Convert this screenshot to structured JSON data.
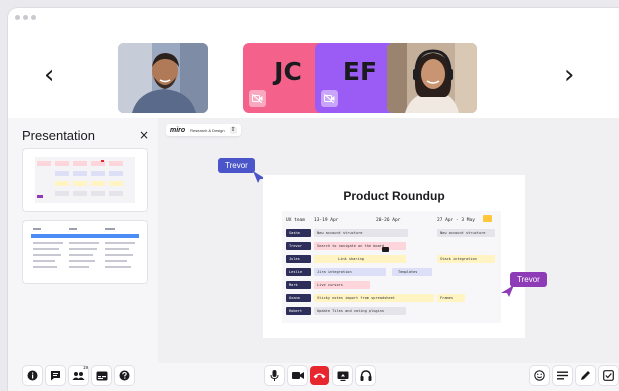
{
  "participants": [
    {
      "name": "participant-1",
      "initials": "",
      "video": true,
      "bg": "#8a9ab8"
    },
    {
      "name": "participant-jc",
      "initials": "JC",
      "video": false,
      "bg": "#f4628b"
    },
    {
      "name": "participant-ef",
      "initials": "EF",
      "video": false,
      "bg": "#9b5cf6"
    },
    {
      "name": "participant-4",
      "initials": "",
      "video": true,
      "bg": "#b9a38c"
    }
  ],
  "sidebar": {
    "title": "Presentation",
    "close": "×"
  },
  "miro": {
    "logo": "miro",
    "board_name": "Research & Design",
    "share_icon": "⇧"
  },
  "cursors": [
    {
      "label": "Trevor",
      "color": "#4a55c9"
    },
    {
      "label": "Trevor",
      "color": "#8d3bb6"
    }
  ],
  "frame": {
    "title": "Product Roundup",
    "headers": [
      "UX team",
      "13-19 Apr",
      "20-26 Apr",
      "27 Apr - 3 May"
    ],
    "rows": [
      {
        "name": "Sasha",
        "cells": [
          {
            "text": "New account structure",
            "color": "#e4e4ea"
          },
          {
            "text": "New account structure",
            "color": "#e4e4ea"
          }
        ]
      },
      {
        "name": "Trevor",
        "cells": [
          {
            "text": "Search to navigate on the board",
            "color": "#ffd5dc"
          }
        ]
      },
      {
        "name": "Jules",
        "cells": [
          {
            "text": "Link sharing",
            "color": "#fff4c2"
          },
          {
            "text": "Stack integration",
            "color": "#fff4c2"
          }
        ]
      },
      {
        "name": "Leslie",
        "cells": [
          {
            "text": "Jira integration",
            "color": "#dcdff5"
          },
          {
            "text": "Templates",
            "color": "#dcdff5"
          }
        ]
      },
      {
        "name": "Mark",
        "cells": [
          {
            "text": "Live cursors",
            "color": "#ffd5dc"
          }
        ]
      },
      {
        "name": "Oxana",
        "cells": [
          {
            "text": "Sticky notes import from spreadsheet",
            "color": "#fff4c2"
          },
          {
            "text": "Frames",
            "color": "#fff4c2"
          }
        ]
      },
      {
        "name": "Robert",
        "cells": [
          {
            "text": "Update Tiles and voting plugins",
            "color": "#e4e4ea"
          }
        ]
      }
    ]
  },
  "toolbar": {
    "left": [
      "info-icon",
      "chat-icon",
      "participants-icon",
      "captions-icon",
      "help-icon"
    ],
    "participants_count": "19",
    "center": [
      "microphone-icon",
      "camera-icon",
      "hang-up-icon",
      "share-screen-icon",
      "headphones-icon"
    ],
    "right": [
      "emoji-icon",
      "menu-icon",
      "pen-icon",
      "checkbox-icon"
    ],
    "hangup_color": "#e8262e"
  }
}
